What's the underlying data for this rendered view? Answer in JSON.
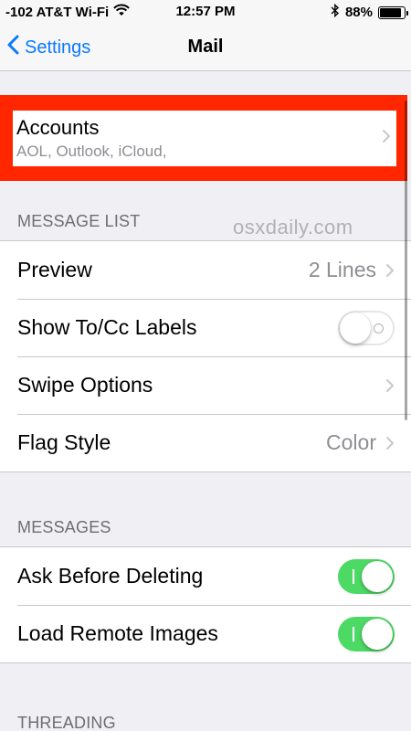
{
  "status_bar": {
    "carrier": "-102 AT&T Wi-Fi",
    "time": "12:57 PM",
    "battery_percent": "88%",
    "battery_level": 0.88,
    "icons": [
      "wifi-icon",
      "bluetooth-icon",
      "battery-icon"
    ]
  },
  "nav": {
    "back_label": "Settings",
    "title": "Mail"
  },
  "accounts": {
    "title": "Accounts",
    "subtitle": "AOL, Outlook, iCloud,",
    "highlight_color": "#ff2600"
  },
  "watermark": "osxdaily.com",
  "message_list": {
    "header": "MESSAGE LIST",
    "rows": [
      {
        "label": "Preview",
        "value": "2 Lines"
      },
      {
        "label": "Show To/Cc Labels",
        "toggle": false
      },
      {
        "label": "Swipe Options"
      },
      {
        "label": "Flag Style",
        "value": "Color"
      }
    ]
  },
  "messages": {
    "header": "MESSAGES",
    "rows": [
      {
        "label": "Ask Before Deleting",
        "toggle": true
      },
      {
        "label": "Load Remote Images",
        "toggle": true
      }
    ]
  },
  "threading": {
    "header": "THREADING"
  },
  "colors": {
    "accent": "#0a7aff",
    "toggle_on": "#4cd964",
    "background": "#efeff4"
  }
}
